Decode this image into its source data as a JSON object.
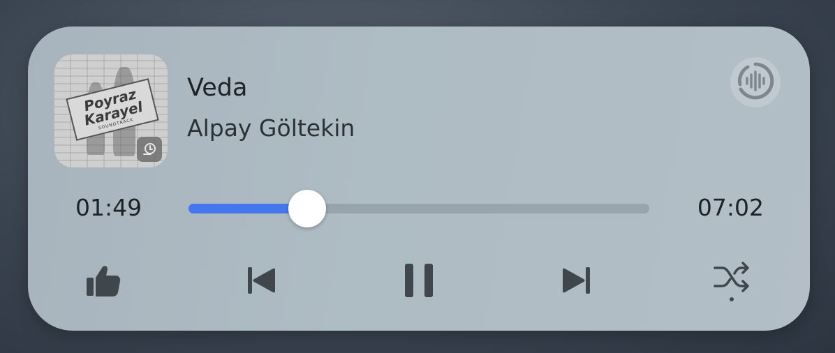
{
  "player": {
    "track_title": "Veda",
    "artist": "Alpay Göltekin",
    "elapsed": "01:49",
    "duration": "07:02",
    "progress_fraction": 0.2581,
    "accent_color": "#4477ee",
    "album_art": {
      "line1": "Poyraz",
      "line2": "Karayel",
      "line3": "SOUNDTRACK"
    },
    "icons": {
      "album_badge": "music-app-icon",
      "cast": "audio-waveform-icon",
      "like": "thumbs-up-icon",
      "previous": "skip-previous-icon",
      "pause": "pause-icon",
      "next": "skip-next-icon",
      "shuffle": "shuffle-icon"
    }
  }
}
